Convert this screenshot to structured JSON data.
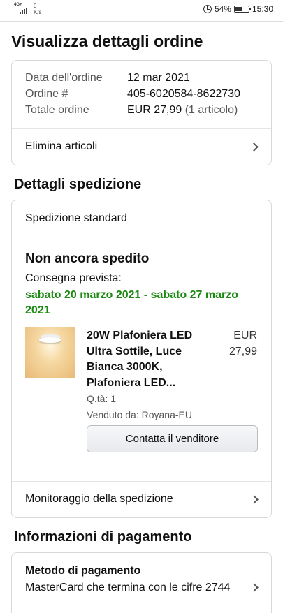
{
  "status_bar": {
    "network_label": "4G+",
    "speed_value": "0",
    "speed_unit": "K/s",
    "battery": "54%",
    "time": "15:30"
  },
  "page_title": "Visualizza dettagli ordine",
  "summary": {
    "date_label": "Data dell'ordine",
    "date_value": "12 mar 2021",
    "order_label": "Ordine #",
    "order_value": "405-6020584-8622730",
    "total_label": "Totale ordine",
    "total_value": "EUR 27,99",
    "total_items": "(1 articolo)",
    "delete_link": "Elimina articoli"
  },
  "shipping_section_title": "Dettagli spedizione",
  "shipping": {
    "method": "Spedizione standard",
    "status": "Non ancora spedito",
    "delivery_label": "Consegna prevista:",
    "delivery_dates": "sabato 20 marzo 2021 - sabato 27 marzo 2021",
    "product_title": "20W Plafoniera LED Ultra Sottile, Luce Bianca 3000K, Plafoniera LED...",
    "price_currency": "EUR",
    "price_value": "27,99",
    "quantity": "Q.tà: 1",
    "seller": "Venduto da: Royana-EU",
    "contact_button": "Contatta il venditore",
    "tracking_link": "Monitoraggio della spedizione"
  },
  "payment_section_title": "Informazioni di pagamento",
  "payment": {
    "title": "Metodo di pagamento",
    "description": "MasterCard che termina con le cifre 2744"
  },
  "colors": {
    "delivery_green": "#1c8a12",
    "card_border": "#d5d9d9"
  },
  "icons": [
    "network-signal-icon",
    "alarm-icon",
    "battery-icon",
    "chevron-right-icon"
  ]
}
